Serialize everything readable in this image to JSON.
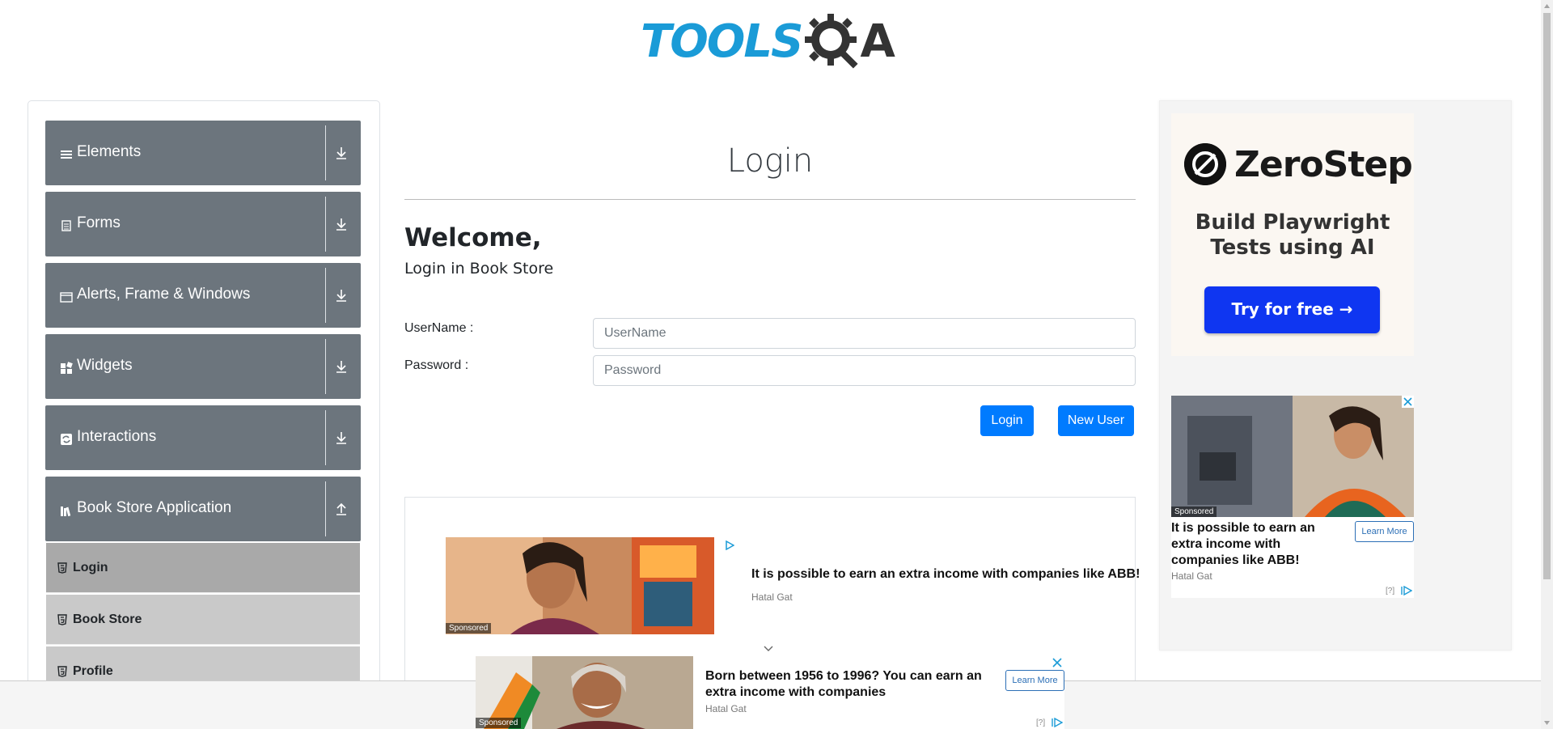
{
  "header": {
    "logo_text": "TOOLS",
    "logo_suffix": "A"
  },
  "sidebar": {
    "groups": [
      {
        "label": "Elements",
        "icon": "menu-icon",
        "expanded": false
      },
      {
        "label": "Forms",
        "icon": "document-icon",
        "expanded": false
      },
      {
        "label": "Alerts, Frame & Windows",
        "icon": "window-icon",
        "expanded": false
      },
      {
        "label": "Widgets",
        "icon": "widgets-icon",
        "expanded": false
      },
      {
        "label": "Interactions",
        "icon": "interactions-icon",
        "expanded": false
      },
      {
        "label": "Book Store Application",
        "icon": "books-icon",
        "expanded": true
      }
    ],
    "bookstore_items": [
      {
        "label": "Login",
        "active": true
      },
      {
        "label": "Book Store",
        "active": false
      },
      {
        "label": "Profile",
        "active": false
      }
    ]
  },
  "main": {
    "title": "Login",
    "welcome": "Welcome,",
    "subtitle": "Login in Book Store",
    "username_label": "UserName :",
    "username_placeholder": "UserName",
    "password_label": "Password :",
    "password_placeholder": "Password",
    "login_button": "Login",
    "new_user_button": "New User"
  },
  "ads": {
    "inline": {
      "sponsored": "Sponsored",
      "title": "It is possible to earn an extra income with companies like ABB!",
      "source": "Hatal Gat"
    },
    "zerostep": {
      "brand": "ZeroStep",
      "tagline_1": "Build Playwright",
      "tagline_2": "Tests using AI",
      "cta": "Try for free →"
    },
    "side": {
      "sponsored": "Sponsored",
      "title": "It is possible to earn an extra income with companies like ABB!",
      "source": "Hatal Gat",
      "learn_more": "Learn More",
      "question": "[?]"
    },
    "sticky": {
      "sponsored": "Sponsored",
      "title": "Born between 1956 to 1996? You can earn an extra income with companies",
      "source": "Hatal Gat",
      "learn_more": "Learn More",
      "question": "[?]"
    }
  },
  "colors": {
    "brand_blue": "#1a9bd7",
    "sidebar_group": "#6c757d",
    "sub_active": "#a9a9a9",
    "sub_item": "#c9c9c9",
    "primary_button": "#007bff",
    "zerostep_cta": "#0f36f1"
  }
}
